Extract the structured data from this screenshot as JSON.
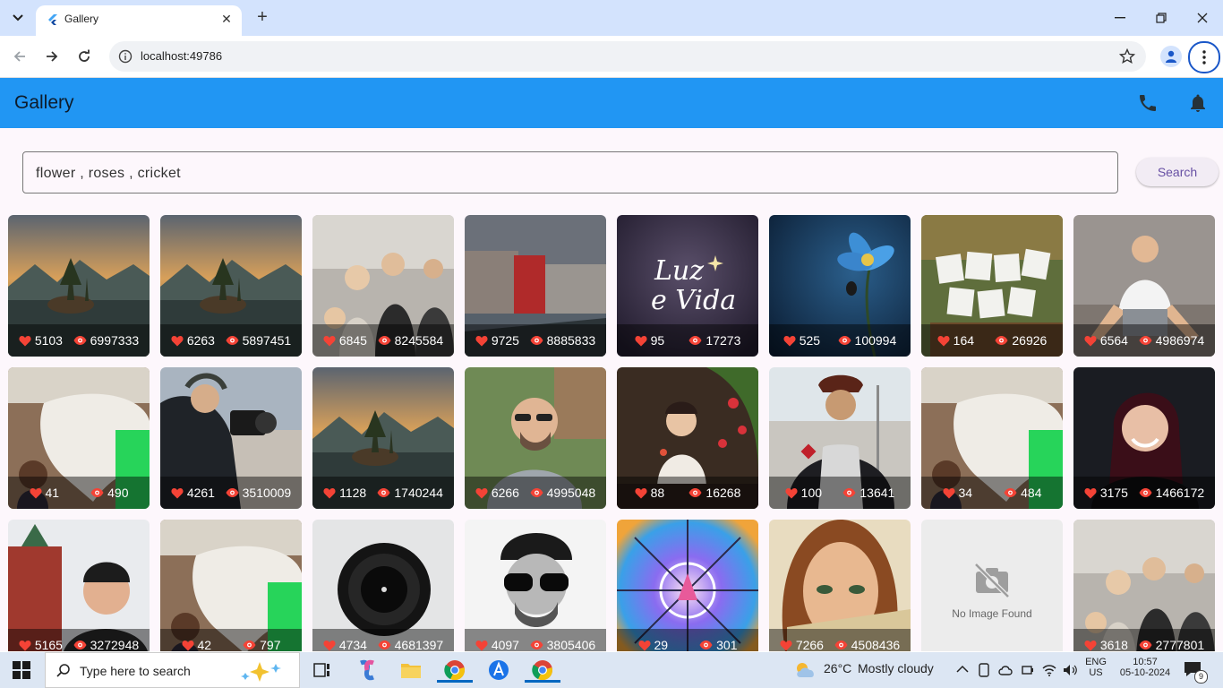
{
  "browser": {
    "tab_title": "Gallery",
    "url": "localhost:49786"
  },
  "app": {
    "title": "Gallery",
    "accent_color": "#2196f3"
  },
  "search": {
    "value": "flower , roses , cricket",
    "button_label": "Search"
  },
  "cards": [
    {
      "likes": "5103",
      "views": "6997333",
      "subject": "lake-island-tree"
    },
    {
      "likes": "6263",
      "views": "5897451",
      "subject": "lake-island-tree"
    },
    {
      "likes": "6845",
      "views": "8245584",
      "subject": "friends-selfie"
    },
    {
      "likes": "9725",
      "views": "8885833",
      "subject": "waterfront-buildings"
    },
    {
      "likes": "95",
      "views": "17273",
      "subject": "luz-e-vida-logo",
      "overlay_text_1": "Luz",
      "overlay_text_2": "e Vida"
    },
    {
      "likes": "525",
      "views": "100994",
      "subject": "blue-flower"
    },
    {
      "likes": "164",
      "views": "26926",
      "subject": "time-out-sign"
    },
    {
      "likes": "6564",
      "views": "4986974",
      "subject": "man-crouching"
    },
    {
      "likes": "41",
      "views": "490",
      "subject": "girl-white-horse"
    },
    {
      "likes": "4261",
      "views": "3510009",
      "subject": "photographer-city"
    },
    {
      "likes": "1128",
      "views": "1740244",
      "subject": "lake-island-tree"
    },
    {
      "likes": "6266",
      "views": "4995048",
      "subject": "man-glasses"
    },
    {
      "likes": "88",
      "views": "16268",
      "subject": "girl-flowers"
    },
    {
      "likes": "100",
      "views": "13641",
      "subject": "man-hat-sword"
    },
    {
      "likes": "34",
      "views": "484",
      "subject": "girl-white-horse"
    },
    {
      "likes": "3175",
      "views": "1466172",
      "subject": "woman-smiling"
    },
    {
      "likes": "5165",
      "views": "3272948",
      "subject": "man-kremlin"
    },
    {
      "likes": "42",
      "views": "797",
      "subject": "girl-white-horse"
    },
    {
      "likes": "4734",
      "views": "4681397",
      "subject": "camera-lens"
    },
    {
      "likes": "4097",
      "views": "3805406",
      "subject": "man-sunglasses-bw"
    },
    {
      "likes": "29",
      "views": "301",
      "subject": "colorful-dome"
    },
    {
      "likes": "7266",
      "views": "4508436",
      "subject": "painted-woman-face"
    },
    {
      "likes": "",
      "views": "",
      "subject": "no-image",
      "placeholder_label": "No Image Found"
    },
    {
      "likes": "3618",
      "views": "2777801",
      "subject": "friends-selfie"
    }
  ],
  "taskbar": {
    "search_placeholder": "Type here to search",
    "weather_temp": "26°C",
    "weather_desc": "Mostly cloudy",
    "lang_1": "ENG",
    "lang_2": "US",
    "time": "10:57",
    "date": "05-10-2024",
    "notification_count": "9"
  }
}
